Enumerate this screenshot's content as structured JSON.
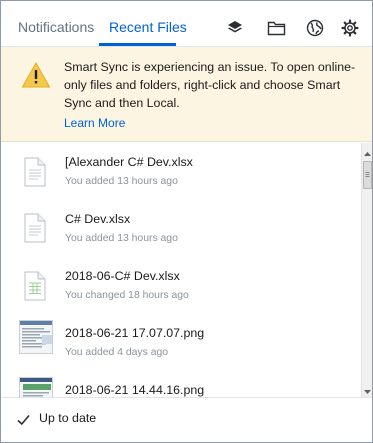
{
  "tabs": [
    {
      "label": "Notifications",
      "active": false
    },
    {
      "label": "Recent Files",
      "active": true
    }
  ],
  "header_icons": [
    "layers-icon",
    "folder-icon",
    "globe-icon",
    "gear-icon"
  ],
  "banner": {
    "icon": "warning-triangle-icon",
    "message": "Smart Sync is experiencing an issue. To open online-only files and folders, right-click and choose Smart Sync and then Local.",
    "link": "Learn More"
  },
  "files": [
    {
      "name": "[Alexander C# Dev.xlsx",
      "activity": "You added 13 hours ago",
      "icon": "document-icon"
    },
    {
      "name": "C# Dev.xlsx",
      "activity": "You added 13 hours ago",
      "icon": "document-icon"
    },
    {
      "name": "2018-06-C# Dev.xlsx",
      "activity": "You changed 18 hours ago",
      "icon": "spreadsheet-icon"
    },
    {
      "name": "2018-06-21 17.07.07.png",
      "activity": "You added 4 days ago",
      "icon": "image-thumbnail"
    },
    {
      "name": "2018-06-21 14.44.16.png",
      "activity": "",
      "icon": "image-thumbnail"
    }
  ],
  "footer": {
    "status": "Up to date",
    "icon": "checkmark-icon"
  },
  "colors": {
    "accent": "#0061d5",
    "banner_bg": "#fbf5e2",
    "warning": "#f7c948",
    "muted_text": "#8b949c"
  }
}
